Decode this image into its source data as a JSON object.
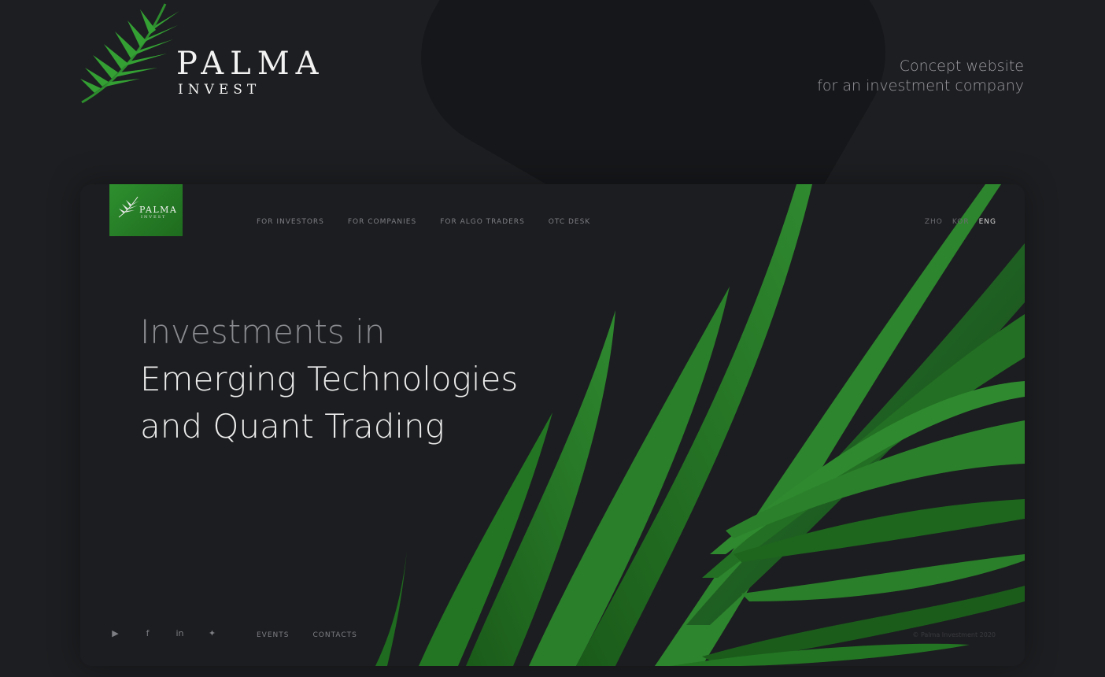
{
  "brand": {
    "name": "PALMA",
    "subtitle": "INVEST"
  },
  "concept": {
    "line1": "Concept website",
    "line2": "for an investment company"
  },
  "site": {
    "logo": {
      "name": "PALMA",
      "subtitle": "INVEST"
    },
    "nav": [
      "FOR INVESTORS",
      "FOR COMPANIES",
      "FOR ALGO TRADERS",
      "OTC DESK"
    ],
    "languages": [
      "ZHO",
      "KOR",
      "ENG"
    ],
    "active_language": "ENG",
    "hero": {
      "line1": "Investments in",
      "line2": "Emerging Technologies",
      "line3": "and Quant Trading"
    },
    "social_icons": [
      "youtube-icon",
      "facebook-icon",
      "linkedin-icon",
      "twitter-icon"
    ],
    "footer_nav": [
      "EVENTS",
      "CONTACTS"
    ],
    "copyright": "© Palma Investment 2020"
  },
  "colors": {
    "background": "#1d1e21",
    "card": "#1c1d20",
    "accent_green": "#2e8f2e"
  }
}
